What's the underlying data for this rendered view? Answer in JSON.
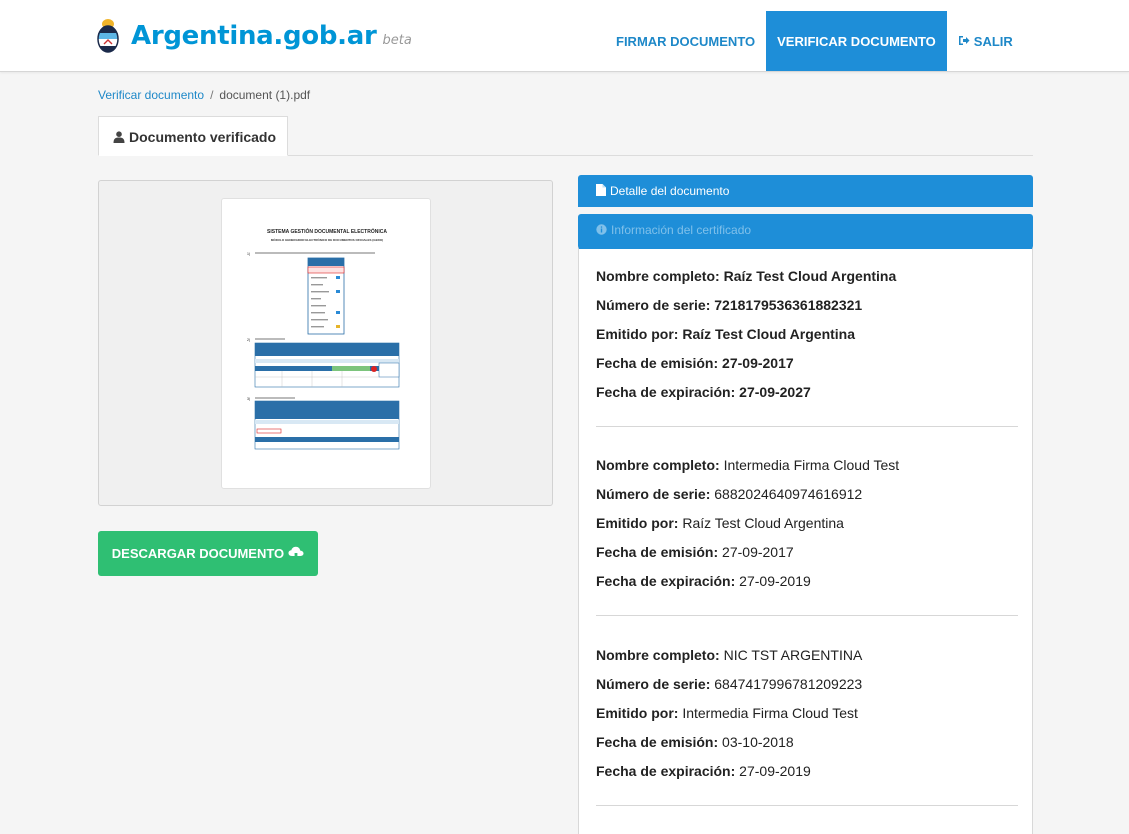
{
  "header": {
    "logo_text": "Argentina.gob.ar",
    "logo_beta": "beta",
    "nav": [
      {
        "label": "FIRMAR DOCUMENTO"
      },
      {
        "label": "VERIFICAR DOCUMENTO"
      },
      {
        "label": "SALIR"
      }
    ]
  },
  "breadcrumb": {
    "link": "Verificar documento",
    "sep": "/",
    "current": "document (1).pdf"
  },
  "tab": {
    "label": "Documento verificado"
  },
  "preview_doc": {
    "title": "SISTEMA GESTIÓN DOCUMENTAL ELECTRÓNICA",
    "subtitle": "MÓDULO GENERADOR ELECTRÓNICO DE DOCUMENTOS OFICIALES (GEDO)",
    "step1": "1)",
    "step2": "2)",
    "step3": "3)"
  },
  "download": {
    "label": "DESCARGAR DOCUMENTO"
  },
  "accordion": {
    "detail": "Detalle del documento",
    "cert_info": "Información del certificado"
  },
  "certificates": [
    {
      "nombre_label": "Nombre completo:",
      "nombre": "Raíz Test Cloud Argentina",
      "serie_label": "Número de serie:",
      "serie": "7218179536361882321",
      "emitido_label": "Emitido por:",
      "emitido": "Raíz Test Cloud Argentina",
      "emision_label": "Fecha de emisión:",
      "emision": "27-09-2017",
      "expiracion_label": "Fecha de expiración:",
      "expiracion": "27-09-2027"
    },
    {
      "nombre_label": "Nombre completo:",
      "nombre": "Intermedia Firma Cloud Test",
      "serie_label": "Número de serie:",
      "serie": "6882024640974616912",
      "emitido_label": "Emitido por:",
      "emitido": "Raíz Test Cloud Argentina",
      "emision_label": "Fecha de emisión:",
      "emision": "27-09-2017",
      "expiracion_label": "Fecha de expiración:",
      "expiracion": "27-09-2019"
    },
    {
      "nombre_label": "Nombre completo:",
      "nombre": "NIC TST ARGENTINA",
      "serie_label": "Número de serie:",
      "serie": "6847417996781209223",
      "emitido_label": "Emitido por:",
      "emitido": "Intermedia Firma Cloud Test",
      "emision_label": "Fecha de emisión:",
      "emision": "03-10-2018",
      "expiracion_label": "Fecha de expiración:",
      "expiracion": "27-09-2019"
    }
  ],
  "colors": {
    "brand_blue": "#0095d6",
    "nav_active": "#1e8ed8",
    "download_green": "#2fbf73"
  }
}
